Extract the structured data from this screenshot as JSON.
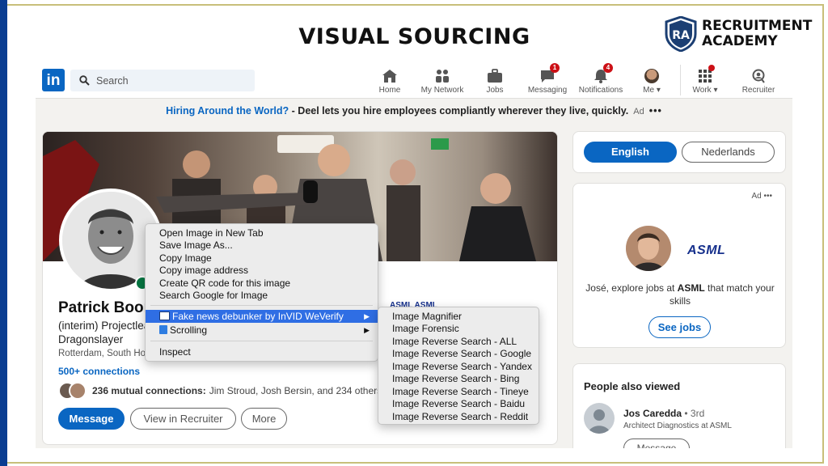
{
  "slide": {
    "title": "VISUAL SOURCING",
    "brand_line1": "RECRUITMENT",
    "brand_line2": "ACADEMY",
    "brand_initials": "RA"
  },
  "colors": {
    "linkedin_blue": "#0a66c2",
    "slide_bar": "#0a3d91",
    "frame_gold": "#c8bf7a",
    "badge_red": "#cc1016",
    "menu_highlight": "#2f6ee4",
    "asml_blue": "#16308c"
  },
  "linkedin": {
    "logo_text": "in",
    "search_placeholder": "Search",
    "nav": [
      {
        "label": "Home",
        "icon": "home-icon"
      },
      {
        "label": "My Network",
        "icon": "network-icon"
      },
      {
        "label": "Jobs",
        "icon": "briefcase-icon"
      },
      {
        "label": "Messaging",
        "icon": "chat-icon",
        "badge": "1"
      },
      {
        "label": "Notifications",
        "icon": "bell-icon",
        "badge": "4"
      },
      {
        "label": "Me",
        "icon": "avatar-icon"
      },
      {
        "label": "Work",
        "icon": "grid-icon"
      },
      {
        "label": "Recruiter",
        "icon": "recruiter-icon"
      }
    ]
  },
  "banner": {
    "link": "Hiring Around the World?",
    "text": " - Deel lets you hire employees compliantly wherever they live, quickly.",
    "ad": "Ad",
    "dots": "•••"
  },
  "profile": {
    "name": "Patrick Boor",
    "headline_1": "(interim) Projectlea",
    "headline_2": "Dragonslayer",
    "location": "Rotterdam, South Ho",
    "connections": "500+ connections",
    "mutual_count": "236 mutual connections:",
    "mutual_names": "Jim Stroud, Josh Bersin, and 234 others",
    "company": "ASML ASML",
    "buttons": {
      "message": "Message",
      "recruiter": "View in Recruiter",
      "more": "More"
    }
  },
  "context_menu": {
    "items": [
      "Open Image in New Tab",
      "Save Image As...",
      "Copy Image",
      "Copy image address",
      "Create QR code for this image",
      "Search Google for Image"
    ],
    "extension_1": "Fake news debunker by InVID  WeVerify",
    "extension_2": "Scrolling",
    "inspect": "Inspect",
    "arrow": "▶"
  },
  "submenu": [
    "Image Magnifier",
    "Image Forensic",
    "Image Reverse Search - ALL",
    "Image Reverse Search - Google",
    "Image Reverse Search - Yandex",
    "Image Reverse Search - Bing",
    "Image Reverse Search - Tineye",
    "Image Reverse Search - Baidu",
    "Image Reverse Search - Reddit"
  ],
  "language": {
    "english": "English",
    "dutch": "Nederlands"
  },
  "ad_card": {
    "ad": "Ad  •••",
    "logo": "ASML",
    "text_pre": "José, explore jobs at ",
    "text_bold": "ASML",
    "text_post": " that match your skills",
    "cta": "See jobs"
  },
  "people_also_viewed": {
    "title": "People also viewed",
    "name": "Jos Caredda",
    "degree": " • 3rd",
    "subtitle": "Architect Diagnostics at ASML",
    "button": "Message"
  }
}
